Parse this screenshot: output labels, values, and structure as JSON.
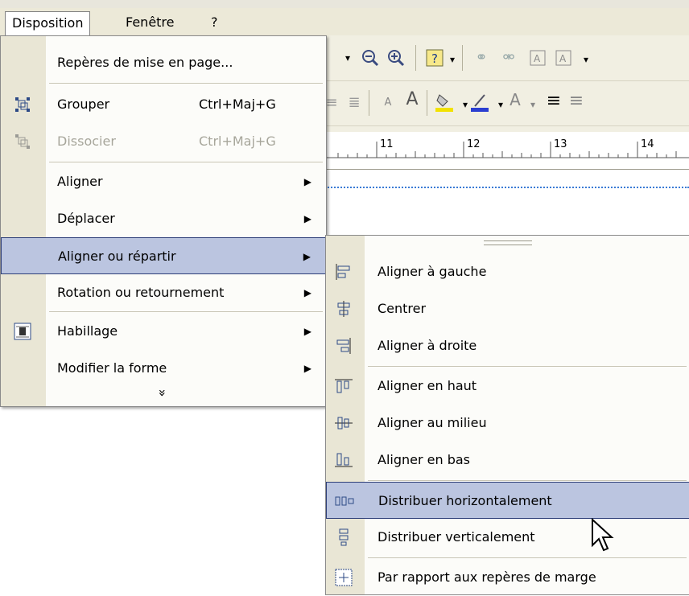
{
  "menubar": {
    "items": [
      {
        "label": "Disposition"
      },
      {
        "label": "Fenêtre"
      },
      {
        "label": "?"
      }
    ]
  },
  "toolbar": {
    "ruler_numbers": [
      "11",
      "12",
      "13",
      "14"
    ]
  },
  "disposition_menu": {
    "items": [
      {
        "label": "Repères de mise en page...",
        "shortcut": "",
        "submenu": false
      },
      {
        "label": "Grouper",
        "shortcut": "Ctrl+Maj+G",
        "submenu": false,
        "icon": "group-icon"
      },
      {
        "label": "Dissocier",
        "shortcut": "Ctrl+Maj+G",
        "submenu": false,
        "disabled": true,
        "icon": "ungroup-icon"
      },
      {
        "label": "Aligner",
        "shortcut": "",
        "submenu": true
      },
      {
        "label": "Déplacer",
        "shortcut": "",
        "submenu": true
      },
      {
        "label": "Aligner ou répartir",
        "shortcut": "",
        "submenu": true,
        "highlighted": true
      },
      {
        "label": "Rotation ou retournement",
        "shortcut": "",
        "submenu": true
      },
      {
        "label": "Habillage",
        "shortcut": "",
        "submenu": true,
        "icon": "text-wrap-icon"
      },
      {
        "label": "Modifier la forme",
        "shortcut": "",
        "submenu": true
      }
    ],
    "more_glyph": "»"
  },
  "align_submenu": {
    "items": [
      {
        "label": "Aligner à gauche",
        "icon": "align-left-icon"
      },
      {
        "label": "Centrer",
        "icon": "align-center-icon"
      },
      {
        "label": "Aligner à droite",
        "icon": "align-right-icon"
      },
      {
        "label": "Aligner en haut",
        "icon": "align-top-icon"
      },
      {
        "label": "Aligner au milieu",
        "icon": "align-middle-icon"
      },
      {
        "label": "Aligner en bas",
        "icon": "align-bottom-icon"
      },
      {
        "label": "Distribuer horizontalement",
        "icon": "distribute-horizontal-icon",
        "highlighted": true
      },
      {
        "label": "Distribuer verticalement",
        "icon": "distribute-vertical-icon"
      },
      {
        "label": "Par rapport aux repères de marge",
        "icon": "margin-guides-icon"
      }
    ]
  },
  "colors": {
    "highlight": "#bbc5e0",
    "highlight_border": "#2d3e78",
    "gutter": "#e9e6d5",
    "menubar": "#ece9d8"
  }
}
